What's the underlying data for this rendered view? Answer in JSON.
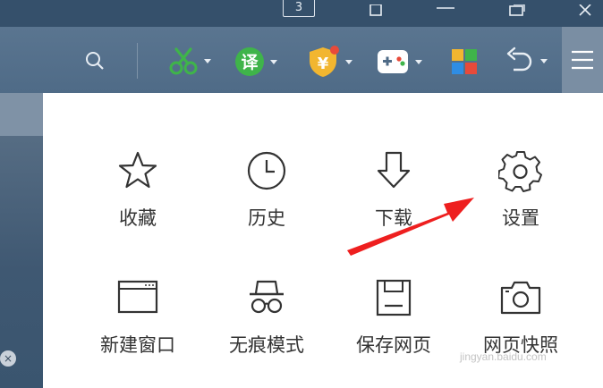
{
  "titlebar": {
    "tab_count": "3",
    "controls": [
      "pin-icon",
      "minimize-icon",
      "restore-icon",
      "close-icon"
    ]
  },
  "toolbar": {
    "tools": [
      {
        "name": "search-icon"
      },
      {
        "name": "scissors-icon",
        "color": "#3fb44a"
      },
      {
        "name": "translate-icon",
        "text": "译",
        "color": "#3fb44a"
      },
      {
        "name": "shield-yen-icon",
        "text": "¥",
        "color": "#f2b630"
      },
      {
        "name": "gamepad-icon"
      },
      {
        "name": "apps-icon"
      },
      {
        "name": "undo-icon"
      },
      {
        "name": "menu-icon"
      }
    ]
  },
  "menu": {
    "items": [
      {
        "label": "收藏",
        "icon": "star-icon"
      },
      {
        "label": "历史",
        "icon": "clock-icon"
      },
      {
        "label": "下载",
        "icon": "download-icon"
      },
      {
        "label": "设置",
        "icon": "gear-icon"
      },
      {
        "label": "新建窗口",
        "icon": "new-window-icon"
      },
      {
        "label": "无痕模式",
        "icon": "incognito-icon"
      },
      {
        "label": "保存网页",
        "icon": "save-icon"
      },
      {
        "label": "网页快照",
        "icon": "camera-icon"
      }
    ]
  },
  "annotation": {
    "color": "#ee1f1f"
  },
  "watermark": "jingyan.baidu.com"
}
